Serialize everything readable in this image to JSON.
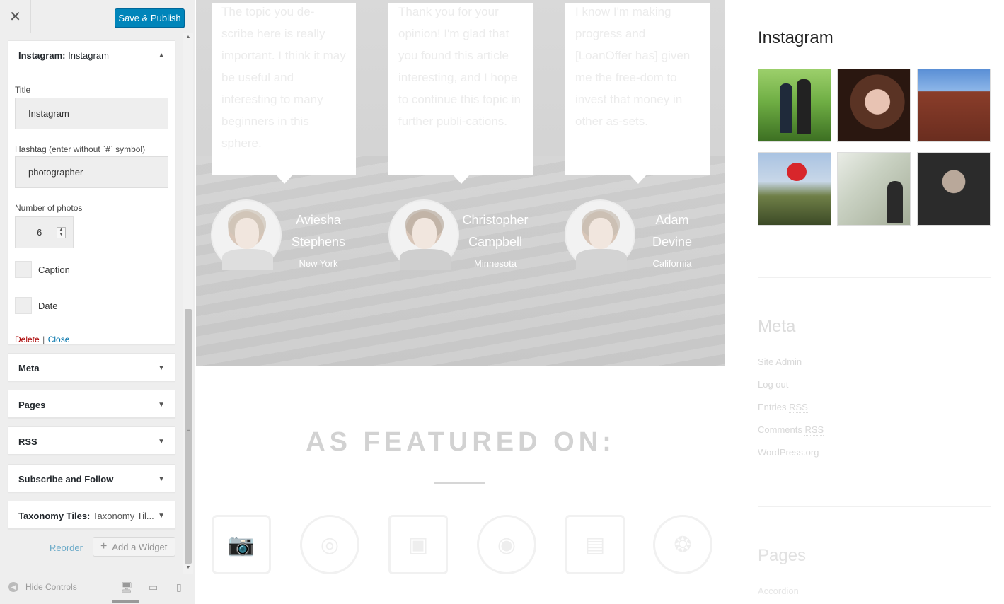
{
  "topbar": {
    "close_icon": "close-icon",
    "publish_label": "Save & Publish"
  },
  "instagram_widget": {
    "header_bold": "Instagram:",
    "header_sub": "Instagram",
    "title_label": "Title",
    "title_value": "Instagram",
    "hashtag_label": "Hashtag (enter without `#` symbol)",
    "hashtag_value": "photographer",
    "number_label": "Number of photos",
    "number_value": "6",
    "caption_label": "Caption",
    "date_label": "Date",
    "delete_label": "Delete",
    "sep": "|",
    "close_label": "Close"
  },
  "widgets": [
    {
      "bold": "Meta",
      "sub": ""
    },
    {
      "bold": "Pages",
      "sub": ""
    },
    {
      "bold": "RSS",
      "sub": ""
    },
    {
      "bold": "Subscribe and Follow",
      "sub": ""
    },
    {
      "bold": "Taxonomy Tiles:",
      "sub": "Taxonomy Til..."
    }
  ],
  "actions": {
    "reorder": "Reorder",
    "add_widget": "Add a Widget"
  },
  "footer": {
    "hide_controls": "Hide Controls"
  },
  "testimonials": [
    {
      "text": "The topic you de-scribe here is really important. I think it may be useful and interesting to many beginners in this sphere.",
      "name_line1": "Aviesha",
      "name_line2": "Stephens",
      "location": "New York"
    },
    {
      "text": "Thank you for your opinion! I'm glad that you found this article interesting, and I hope to continue this topic in further publi-cations.",
      "name_line1": "Christopher",
      "name_line2": "Campbell",
      "location": "Minnesota"
    },
    {
      "text": "I know I'm making progress and [LoanOffer has] given me the free-dom to invest that money in other as-sets.",
      "name_line1": "Adam",
      "name_line2": "Devine",
      "location": "California"
    }
  ],
  "featured": {
    "title": "AS FEATURED ON:",
    "logo_text": "PHOTO"
  },
  "sidebar_preview": {
    "instagram_title": "Instagram",
    "meta_title": "Meta",
    "meta_links": [
      "Site Admin",
      "Log out",
      "Entries",
      "Comments",
      "WordPress.org"
    ],
    "rss": "RSS",
    "pages_title": "Pages",
    "pages_first": "Accordion"
  },
  "colors": {
    "accent": "#0085ba",
    "delete": "#aa0000",
    "link": "#0073aa"
  }
}
